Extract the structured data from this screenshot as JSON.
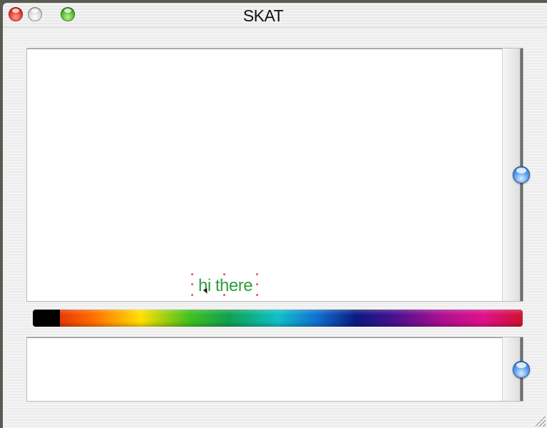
{
  "window": {
    "title": "SKAT"
  },
  "canvas": {
    "text_item": "hi there",
    "text_color": "#2f9b3c",
    "top_slider_value": 0.5,
    "bottom_slider_value": 0.5
  },
  "color_bar": {
    "selected_color": "#000000"
  },
  "icons": {
    "close": "close-button-icon",
    "minimize": "minimize-button-icon",
    "zoom": "zoom-button-icon",
    "resize": "resize-grip-icon"
  }
}
